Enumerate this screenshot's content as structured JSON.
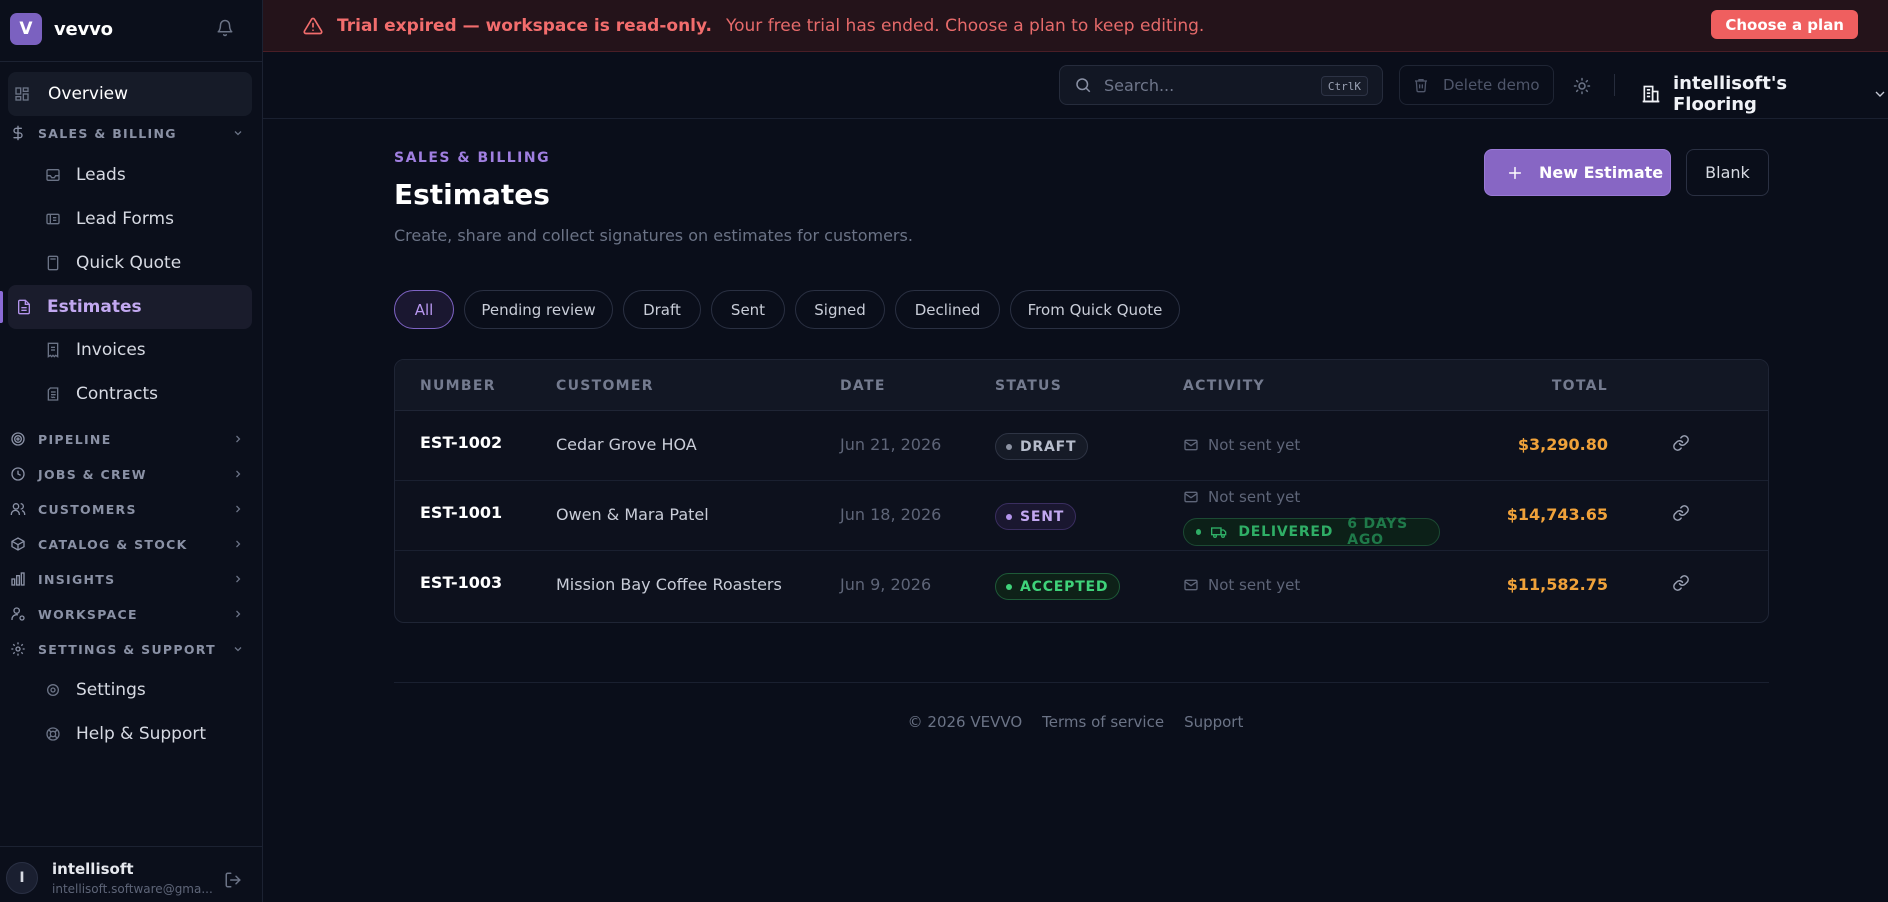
{
  "brand": {
    "logo_letter": "V",
    "name": "vevvo",
    "accent": "#7b61c0"
  },
  "sidebar": {
    "overview": "Overview",
    "sections": [
      {
        "label": "SALES & BILLING",
        "icon": "dollar-icon",
        "expanded": true
      },
      {
        "label": "PIPELINE",
        "icon": "target-icon",
        "expanded": false
      },
      {
        "label": "JOBS & CREW",
        "icon": "schedule-icon",
        "expanded": false
      },
      {
        "label": "CUSTOMERS",
        "icon": "users-icon",
        "expanded": false
      },
      {
        "label": "CATALOG & STOCK",
        "icon": "box-icon",
        "expanded": false
      },
      {
        "label": "INSIGHTS",
        "icon": "bar-chart-icon",
        "expanded": false
      },
      {
        "label": "WORKSPACE",
        "icon": "user-cog-icon",
        "expanded": false
      },
      {
        "label": "SETTINGS & SUPPORT",
        "icon": "gear-icon",
        "expanded": true
      }
    ],
    "sales_items": [
      "Leads",
      "Lead Forms",
      "Quick Quote",
      "Estimates",
      "Invoices",
      "Contracts"
    ],
    "support_items": [
      "Settings",
      "Help & Support"
    ],
    "active_item": "Estimates"
  },
  "user": {
    "initial": "I",
    "name": "intellisoft",
    "email": "intellisoft.software@gma..."
  },
  "banner": {
    "title": "Trial expired — workspace is read-only.",
    "message": "Your free trial has ended. Choose a plan to keep editing.",
    "button": "Choose a plan",
    "color": "#ef5f5f"
  },
  "topbar": {
    "search_placeholder": "Search...",
    "search_shortcut": "CtrlK",
    "delete_demo": "Delete demo",
    "org_name": "intellisoft's Flooring"
  },
  "page": {
    "kicker": "SALES & BILLING",
    "title": "Estimates",
    "subtitle": "Create, share and collect signatures on estimates for customers.",
    "new_button": "New Estimate",
    "blank_button": "Blank"
  },
  "filters": [
    "All",
    "Pending review",
    "Draft",
    "Sent",
    "Signed",
    "Declined",
    "From Quick Quote"
  ],
  "active_filter": "All",
  "table": {
    "headers": [
      "NUMBER",
      "CUSTOMER",
      "DATE",
      "STATUS",
      "ACTIVITY",
      "TOTAL"
    ],
    "rows": [
      {
        "number": "EST-1002",
        "customer": "Cedar Grove HOA",
        "date": "Jun 21, 2026",
        "status": "DRAFT",
        "activity": "Not sent yet",
        "total": "$3,290.80"
      },
      {
        "number": "EST-1001",
        "customer": "Owen & Mara Patel",
        "date": "Jun 18, 2026",
        "status": "SENT",
        "activity": "Not sent yet",
        "delivered": "DELIVERED",
        "delivered_ago": "6 DAYS AGO",
        "total": "$14,743.65"
      },
      {
        "number": "EST-1003",
        "customer": "Mission Bay Coffee Roasters",
        "date": "Jun 9, 2026",
        "status": "ACCEPTED",
        "activity": "Not sent yet",
        "total": "$11,582.75"
      }
    ]
  },
  "footer": {
    "copyright": "© 2026 VEVVO",
    "terms": "Terms of service",
    "support": "Support"
  }
}
